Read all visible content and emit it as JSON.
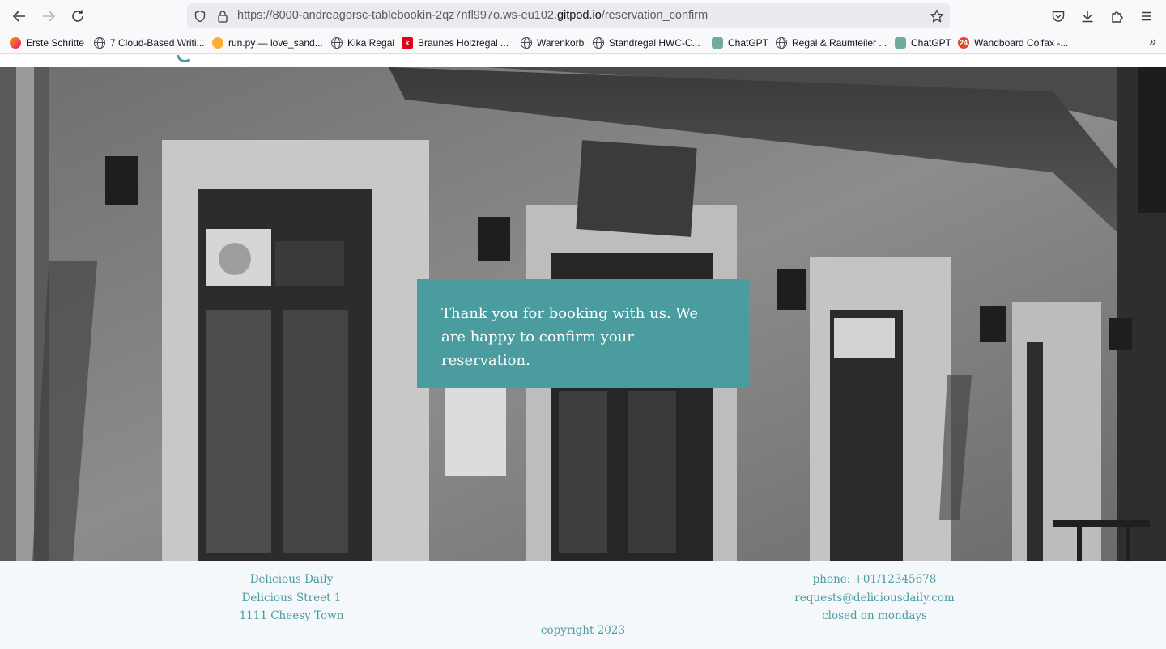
{
  "browser": {
    "url_prefix": "https://8000-andreagorsc-tablebookin-2qz7nfl997o.ws-eu102.",
    "url_host": "gitpod.io",
    "url_path": "/reservation_confirm",
    "bookmarks": [
      {
        "label": "Erste Schritte",
        "icon": "firefox-icon"
      },
      {
        "label": "7 Cloud-Based Writi...",
        "icon": "globe-icon"
      },
      {
        "label": "run.py — love_sand...",
        "icon": "gitpod-icon"
      },
      {
        "label": "Kika Regal",
        "icon": "globe-icon"
      },
      {
        "label": "Braunes Holzregal ...",
        "icon": "kleinanzeigen-icon"
      },
      {
        "label": "Warenkorb",
        "icon": "globe-icon"
      },
      {
        "label": "Standregal HWC-C...",
        "icon": "globe-icon"
      },
      {
        "label": "ChatGPT",
        "icon": "chatgpt-icon"
      },
      {
        "label": "Regal & Raumteiler ...",
        "icon": "globe-icon"
      },
      {
        "label": "ChatGPT",
        "icon": "chatgpt-icon"
      },
      {
        "label": "Wandboard Colfax -...",
        "icon": "shop24-icon"
      }
    ]
  },
  "confirmation": {
    "message": "Thank you for booking with us. We are happy to confirm your reservation."
  },
  "footer": {
    "name": "Delicious Daily",
    "street": "Delicious Street 1",
    "town": "1111 Cheesy Town",
    "phone": "phone: +01/12345678",
    "email": "requests@deliciousdaily.com",
    "hours": "closed on mondays",
    "copyright": "copyright 2023"
  },
  "colors": {
    "accent": "#4a9c9f",
    "footer_bg": "#f4f8fb"
  }
}
